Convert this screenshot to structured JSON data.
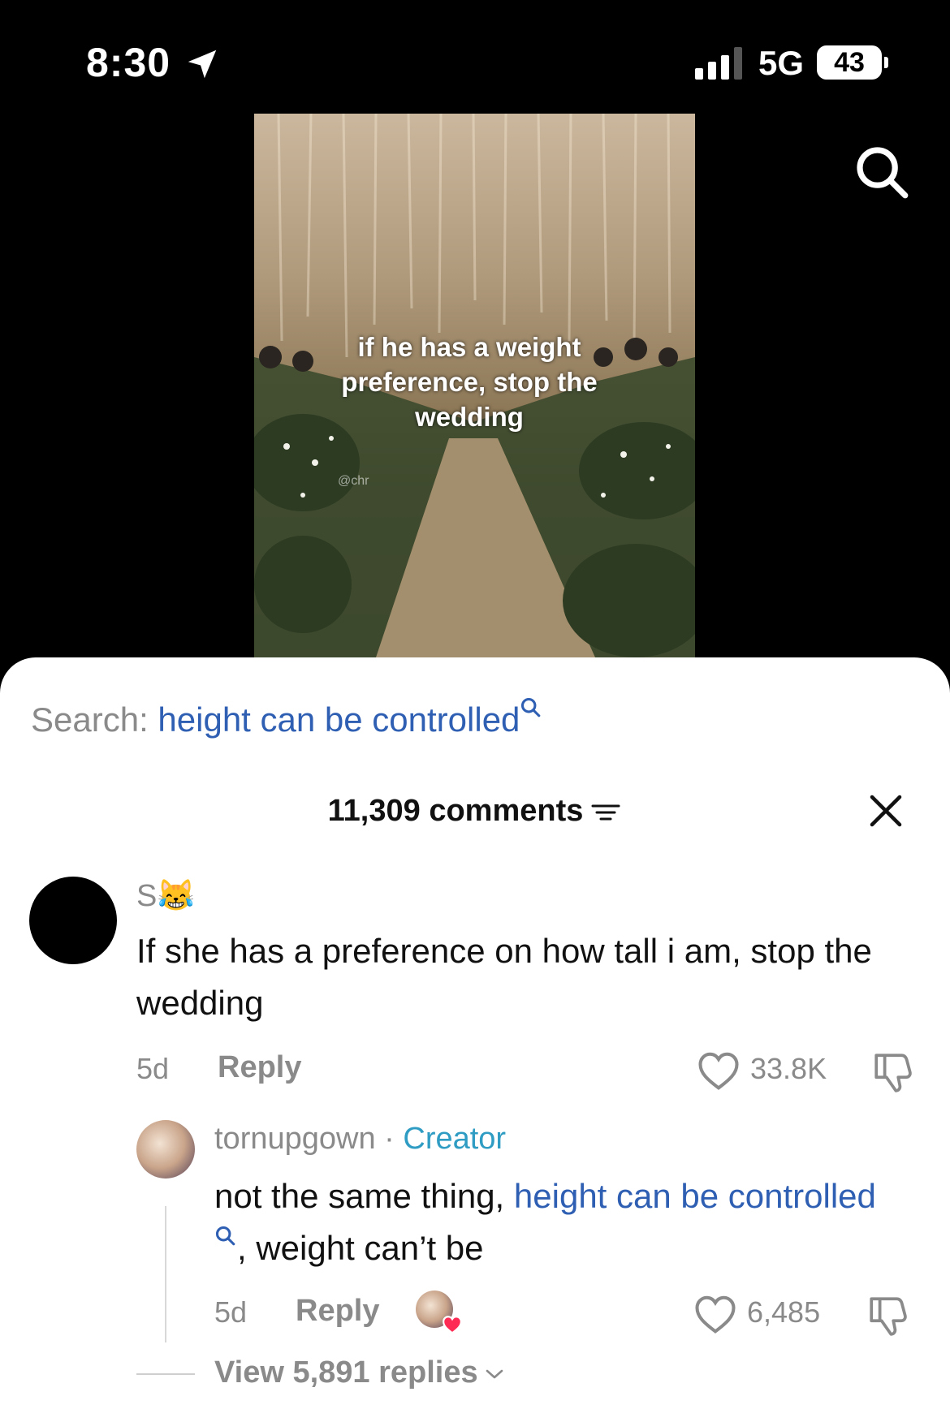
{
  "status_bar": {
    "time": "8:30",
    "network": "5G",
    "battery": "43"
  },
  "video": {
    "overlay_text": "if he has a weight preference, stop the wedding",
    "watermark": "@chr"
  },
  "search": {
    "label": "Search:",
    "query": "height can be controlled"
  },
  "comments_header": {
    "count_label": "11,309 comments"
  },
  "comment": {
    "username": "S😹",
    "text": "If she has a preference on how tall i am, stop the wedding",
    "age": "5d",
    "reply_label": "Reply",
    "likes": "33.8K"
  },
  "creator_reply": {
    "username": "tornupgown",
    "separator": " · ",
    "badge": "Creator",
    "text_before": "not the same thing, ",
    "link_text": "height can be controlled",
    "text_after": ", weight can’t be",
    "age": "5d",
    "reply_label": "Reply",
    "likes": "6,485"
  },
  "view_replies": "View 5,891 replies",
  "colors": {
    "link": "#2f5fb3",
    "creator": "#2f9cc3",
    "muted": "#8a8a8a",
    "like_heart": "#fe2c55"
  }
}
